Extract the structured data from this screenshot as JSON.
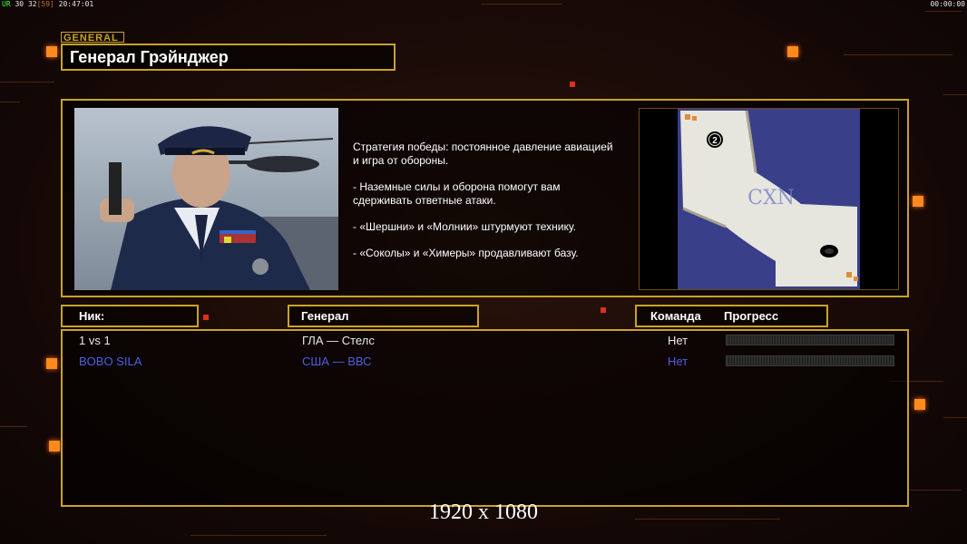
{
  "hud": {
    "prefix_ur": "UR",
    "fps": "30",
    "fps_alt": "32",
    "frame_count": "[59]",
    "clock": "20:47:01",
    "timer": "00:00:00"
  },
  "header": {
    "tag": "GENERAL",
    "title": "Генерал Грэйнджер"
  },
  "strategy": {
    "lines": [
      "Стратегия победы: постоянное давление авиацией\n и игра от обороны.",
      "- Наземные силы и оборона помогут вам\n сдерживать ответные атаки.",
      "- «Шершни» и «Молнии» штурмуют технику.",
      "- «Соколы» и «Химеры» продавливают базу."
    ]
  },
  "minimap": {
    "start_marker": "2",
    "watermark": "CXN"
  },
  "columns": {
    "nick": "Ник:",
    "general": "Генерал",
    "team": "Команда",
    "progress": "Прогресс"
  },
  "players": [
    {
      "nick": "1 vs 1",
      "general": "ГЛА — Стелс",
      "team": "Нет",
      "color": "#e8e8e8"
    },
    {
      "nick": "BOBO  SILA",
      "general": "США — ВВС",
      "team": "Нет",
      "color": "#4f5fe0"
    }
  ],
  "footer": {
    "resolution": "1920 x 1080"
  },
  "colors": {
    "accent_gold": "#c9a227",
    "glow_orange": "#ff8a1e",
    "player_blue": "#4f5fe0"
  }
}
